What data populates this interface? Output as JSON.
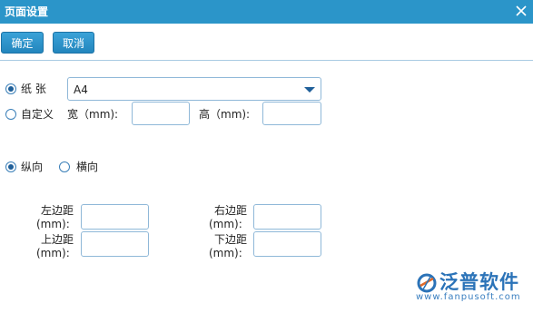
{
  "dialog": {
    "title": "页面设置"
  },
  "toolbar": {
    "ok_label": "确定",
    "cancel_label": "取消"
  },
  "paper": {
    "paper_label": "纸 张",
    "paper_selected": "A4",
    "custom_label": "自定义",
    "width_label": "宽（mm):",
    "height_label": "高（mm):",
    "width_value": "",
    "height_value": ""
  },
  "orientation": {
    "portrait_label": "纵向",
    "landscape_label": "横向",
    "selected": "portrait"
  },
  "margins": {
    "left_line1": "左边距",
    "left_line2": "(mm):",
    "right_line1": "右边距",
    "right_line2": "(mm):",
    "top_line1": "上边距",
    "top_line2": "(mm):",
    "bottom_line1": "下边距",
    "bottom_line2": "(mm):",
    "left_value": "",
    "right_value": "",
    "top_value": "",
    "bottom_value": ""
  },
  "logo": {
    "name": "泛普软件",
    "url": "www.fanpusoft.com"
  },
  "colors": {
    "titlebar": "#2b95c9",
    "button": "#2386bd",
    "radio": "#1f5f99",
    "logo": "#2b73b8"
  }
}
